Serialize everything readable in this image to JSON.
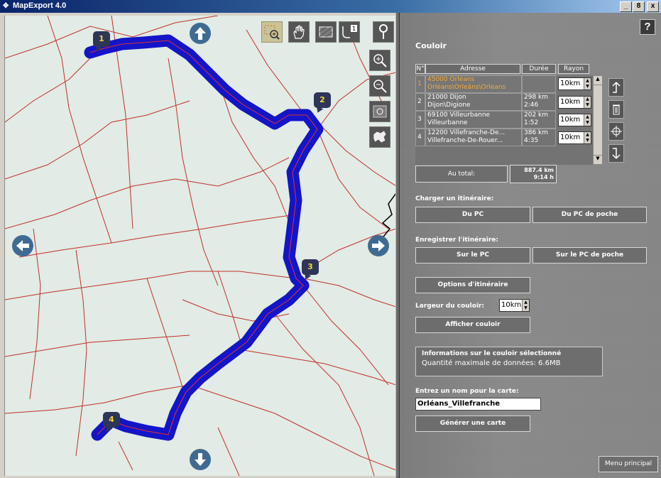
{
  "window": {
    "title": "MapExport 4.0",
    "controls": [
      "_",
      "8",
      "x"
    ]
  },
  "map": {
    "markers": [
      {
        "label": "1"
      },
      {
        "label": "2"
      },
      {
        "label": "3"
      },
      {
        "label": "4"
      }
    ],
    "tools": [
      "select-zoom-icon",
      "pan-hand-icon",
      "area-select-icon",
      "route-step-icon",
      "pin-icon"
    ],
    "zoom_tools": [
      "zoom-in-icon",
      "zoom-out-icon",
      "zoom-area-icon",
      "europe-map-icon"
    ],
    "route_color": "#1414c8",
    "road_color": "#c0302a",
    "background": "#e2ebe5"
  },
  "panel": {
    "help": "?",
    "title": "Couloir",
    "table": {
      "headers": [
        "N°",
        "Adresse",
        "Durée",
        "Rayon"
      ],
      "rows": [
        {
          "num": "1",
          "addr1": "45000 Orléans",
          "addr2": "Orléans\\Orleãns\\Orleans",
          "dist": "",
          "time": "",
          "radius": "10km"
        },
        {
          "num": "2",
          "addr1": "21000 Dijon",
          "addr2": "Dijon\\Digione",
          "dist": "298 km",
          "time": "2:46",
          "radius": "10km"
        },
        {
          "num": "3",
          "addr1": "69100 Villeurbanne",
          "addr2": "Villeurbanne",
          "dist": "202 km",
          "time": "1:52",
          "radius": "10km"
        },
        {
          "num": "4",
          "addr1": "12200 Villefranche-De...",
          "addr2": "Villefranche-De-Rouer...",
          "dist": "386 km",
          "time": "4:35",
          "radius": "10km"
        }
      ]
    },
    "total": {
      "label": "Au total:",
      "dist": "887.4 km",
      "time": "9:14 h"
    },
    "load": {
      "label": "Charger un itinéraire:",
      "pc": "Du PC",
      "pocket": "Du PC de poche"
    },
    "save": {
      "label": "Enregistrer l'itinéraire:",
      "pc": "Sur le PC",
      "pocket": "Sur le PC de poche"
    },
    "options_button": "Options d'itinéraire",
    "width": {
      "label": "Largeur du couloir:",
      "value": "10km"
    },
    "show_button": "Afficher couloir",
    "info": {
      "title": "Informations sur le couloir sélectionné",
      "text": "Quantité maximale de données: 6.6MB"
    },
    "name": {
      "label": "Entrez un nom pour la carte:",
      "value": "Orléans_Villefranche"
    },
    "generate_button": "Générer une carte",
    "menu_button": "Menu principal"
  }
}
